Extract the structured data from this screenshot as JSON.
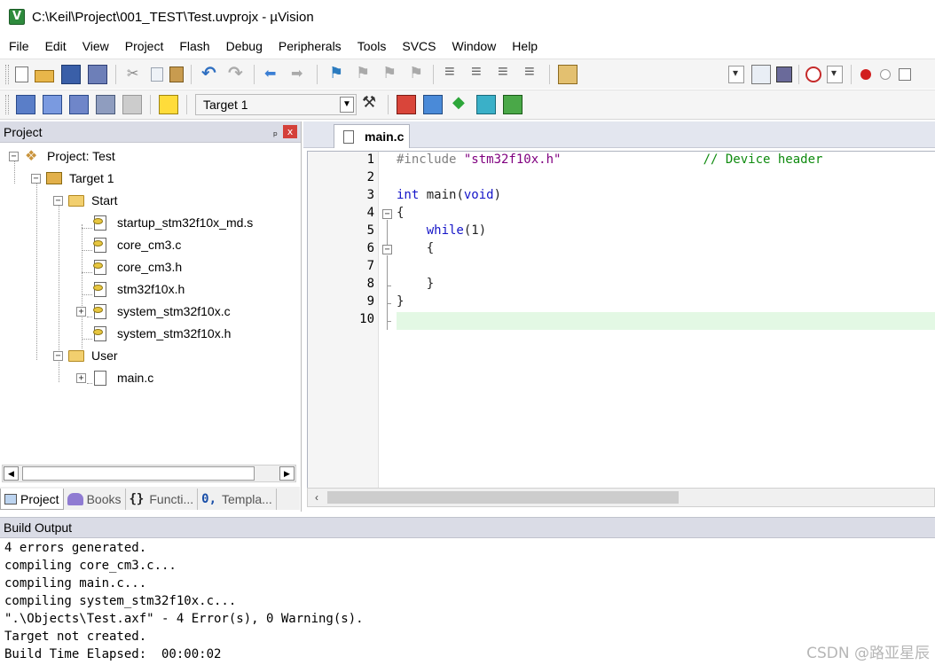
{
  "window": {
    "title": "C:\\Keil\\Project\\001_TEST\\Test.uvprojx - µVision"
  },
  "menu": [
    "File",
    "Edit",
    "View",
    "Project",
    "Flash",
    "Debug",
    "Peripherals",
    "Tools",
    "SVCS",
    "Window",
    "Help"
  ],
  "toolbar2": {
    "target": "Target 1"
  },
  "project_panel": {
    "title": "Project",
    "pin_glyph": "ₚ",
    "close_glyph": "x",
    "tree": {
      "root": "Project: Test",
      "target": "Target 1",
      "group_start": "Start",
      "start_files": [
        "startup_stm32f10x_md.s",
        "core_cm3.c",
        "core_cm3.h",
        "stm32f10x.h",
        "system_stm32f10x.c",
        "system_stm32f10x.h"
      ],
      "group_user": "User",
      "user_files": [
        "main.c"
      ]
    },
    "tabs": [
      "Project",
      "Books",
      "Functi...",
      "Templa..."
    ],
    "tab_glyphs": {
      "functions": "{}",
      "templates": "0,"
    }
  },
  "editor": {
    "tab": "main.c",
    "line_numbers": [
      "1",
      "2",
      "3",
      "4",
      "5",
      "6",
      "7",
      "8",
      "9",
      "10"
    ],
    "code": {
      "l1_pre": "#include ",
      "l1_str": "\"stm32f10x.h\"",
      "l1_pad": "                   ",
      "l1_cmt": "// Device header",
      "l3_kw": "int",
      "l3_mid": " main(",
      "l3_kw2": "void",
      "l3_end": ")",
      "l4": "{",
      "l5_indent": "    ",
      "l5_kw": "while",
      "l5_end": "(1)",
      "l6": "    {",
      "l8": "    }",
      "l9": "}"
    }
  },
  "build_output": {
    "title": "Build Output",
    "lines": [
      "4 errors generated.",
      "compiling core_cm3.c...",
      "compiling main.c...",
      "compiling system_stm32f10x.c...",
      "\".\\Objects\\Test.axf\" - 4 Error(s), 0 Warning(s).",
      "Target not created.",
      "Build Time Elapsed:  00:00:02"
    ]
  },
  "watermark": "CSDN @路亚星辰",
  "colors": {
    "panel_header": "#dadce6",
    "current_line": "#e3f8e4",
    "keyword": "#1515c8",
    "string": "#800080",
    "comment": "#0f8b0f"
  }
}
